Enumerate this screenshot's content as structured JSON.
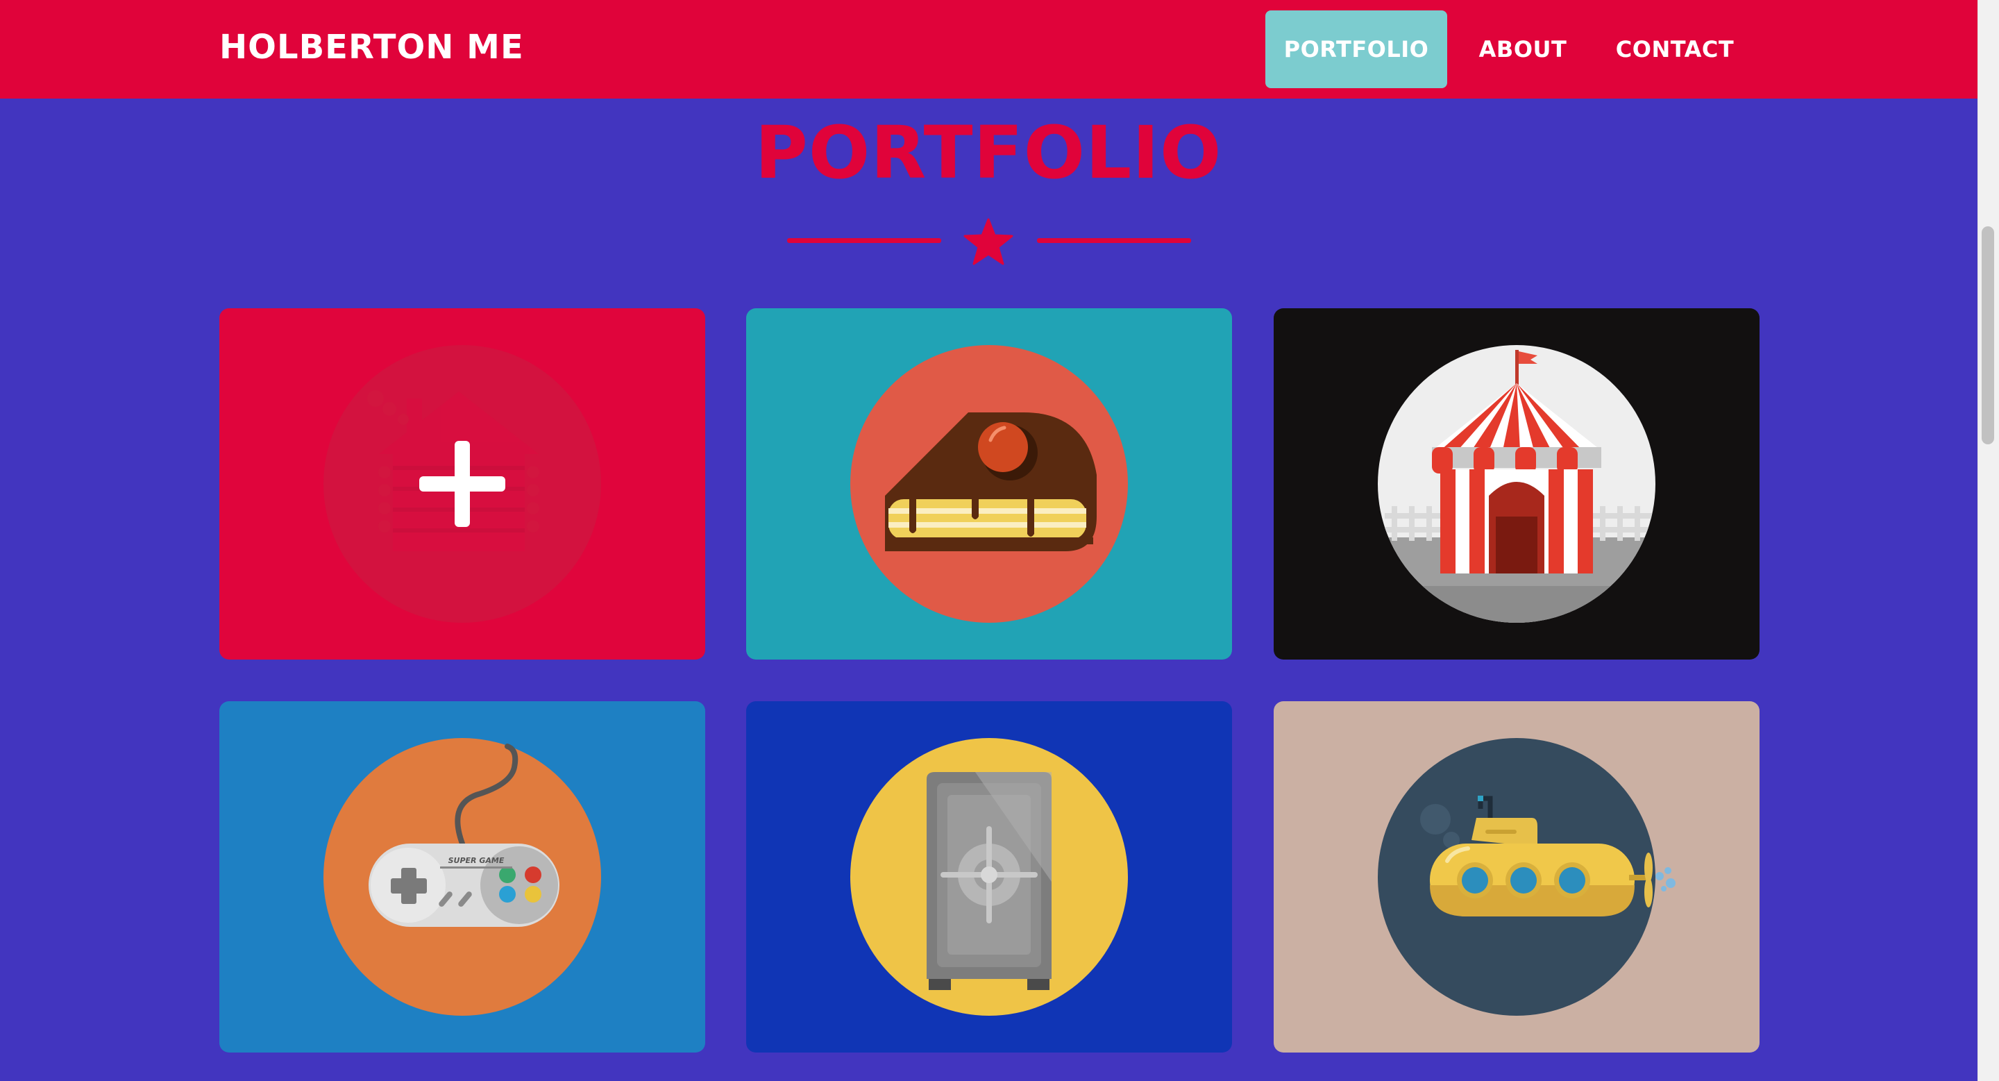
{
  "navbar": {
    "brand": "HOLBERTON ME",
    "links": [
      {
        "label": "PORTFOLIO",
        "active": true
      },
      {
        "label": "ABOUT",
        "active": false
      },
      {
        "label": "CONTACT",
        "active": false
      }
    ]
  },
  "portfolio": {
    "title": "PORTFOLIO",
    "divider_icon": "star-icon",
    "items": [
      {
        "icon": "cabin-icon",
        "overlay_icon": "plus-icon",
        "hovered": true
      },
      {
        "icon": "cake-slice-icon"
      },
      {
        "icon": "circus-tent-icon"
      },
      {
        "icon": "game-controller-icon",
        "controller_text": "SUPER GAME"
      },
      {
        "icon": "safe-icon"
      },
      {
        "icon": "submarine-icon"
      }
    ]
  },
  "colors": {
    "navbar": "#e0033a",
    "background": "#4235bf",
    "accent": "#e0033a",
    "active_link": "#7ccccf"
  }
}
